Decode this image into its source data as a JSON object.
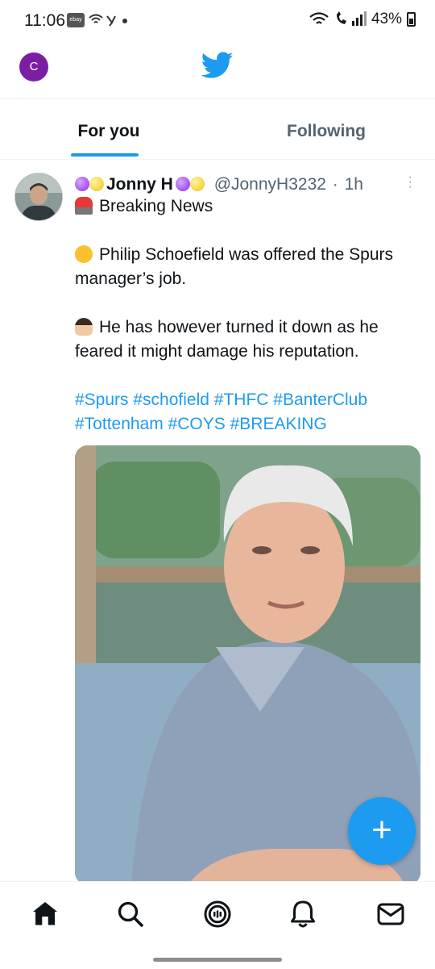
{
  "status_bar": {
    "time": "11:06",
    "ebay_label": "ebay",
    "battery": "43%"
  },
  "header": {
    "account_initial": "C",
    "logo_icon": "twitter-bird-icon"
  },
  "tabs": [
    {
      "label": "For you",
      "active": true
    },
    {
      "label": "Following",
      "active": false
    }
  ],
  "tweet": {
    "display_name": "Jonny H",
    "handle": "@JonnyH3232",
    "separator": "·",
    "time": "1h",
    "lines": {
      "breaking": "Breaking News",
      "para1": "Philip Schoefield was offered the Spurs manager’s job.",
      "para2": "He has however turned it down as he feared it might damage his reputation.",
      "hashtags": "#Spurs #schofield #THFC #BanterClub #Tottenham #COYS #BREAKING"
    }
  },
  "fab": {
    "label": "+"
  },
  "bottom_nav": [
    "home-icon",
    "search-icon",
    "spaces-icon",
    "notifications-icon",
    "messages-icon"
  ],
  "colors": {
    "accent": "#1d9bf0",
    "text": "#0f1419",
    "secondary_text": "#536471",
    "account_avatar": "#7b1fa2"
  }
}
